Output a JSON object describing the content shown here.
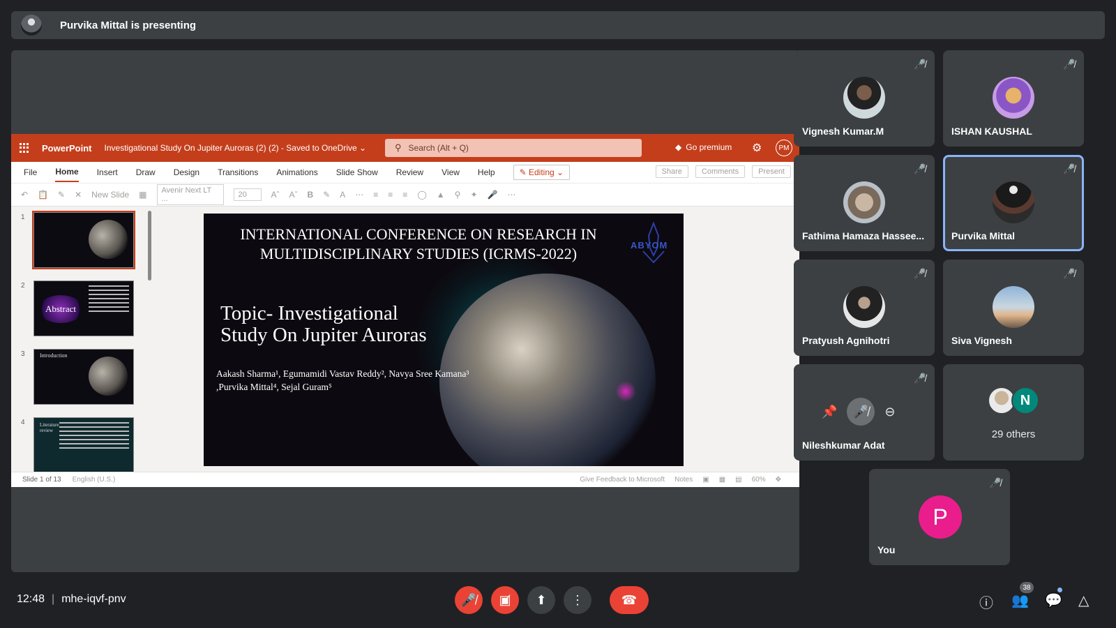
{
  "presenting_bar": {
    "text": "Purvika Mittal is presenting"
  },
  "powerpoint": {
    "app_name": "PowerPoint",
    "doc_title": "Investigational Study On Jupiter Auroras (2) (2)  -  Saved to OneDrive ⌄",
    "search_placeholder": "Search (Alt + Q)",
    "go_premium": "Go premium",
    "user_initials": "PM",
    "menu": [
      "File",
      "Home",
      "Insert",
      "Draw",
      "Design",
      "Transitions",
      "Animations",
      "Slide Show",
      "Review",
      "View",
      "Help"
    ],
    "active_menu": "Home",
    "editing_label": "Editing ⌄",
    "share_label": "Share",
    "comments_label": "Comments",
    "present_label": "Present",
    "ribbon": {
      "new_slide": "New Slide",
      "font": "Avenir Next LT ...",
      "size": "20"
    },
    "slide_numbers": [
      "1",
      "2",
      "3",
      "4"
    ],
    "thumb2_label": "Abstract",
    "thumb3_label": "Introduction",
    "thumb4_label": "Literature review",
    "slide": {
      "conference": "INTERNATIONAL CONFERENCE ON RESEARCH IN MULTIDISCIPLINARY STUDIES (ICRMS-2022)",
      "topic_line1": "Topic- Investigational",
      "topic_line2": "Study On Jupiter Auroras",
      "authors_line1": "Aakash Sharma¹, Egumamidi Vastav Reddy², Navya Sree Kamana³",
      "authors_line2": ",Purvika Mittal⁴, Sejal Guram⁵",
      "logo_text": "ABYOM"
    },
    "status": {
      "slide_count": "Slide 1 of 13",
      "language": "English (U.S.)",
      "feedback": "Give Feedback to Microsoft",
      "notes": "Notes",
      "zoom": "60%"
    }
  },
  "participants": [
    {
      "name": "Vignesh Kumar.M",
      "muted": true
    },
    {
      "name": "ISHAN KAUSHAL",
      "muted": true
    },
    {
      "name": "Fathima Hamaza Hassee...",
      "muted": true
    },
    {
      "name": "Purvika Mittal",
      "muted": true,
      "active_speaker": true
    },
    {
      "name": "Pratyush Agnihotri",
      "muted": true
    },
    {
      "name": "Siva Vignesh",
      "muted": true
    },
    {
      "name": "Nileshkumar Adat",
      "muted": true
    },
    {
      "name": "You",
      "muted": true,
      "initial": "P"
    }
  ],
  "others": {
    "label": "29 others",
    "initial": "N"
  },
  "bottom_bar": {
    "time": "12:48",
    "meeting_code": "mhe-iqvf-pnv",
    "people_count": "38"
  },
  "colors": {
    "accent": "#c43e1c",
    "danger": "#ea4335",
    "tile_bg": "#3c4043",
    "background": "#202124"
  }
}
